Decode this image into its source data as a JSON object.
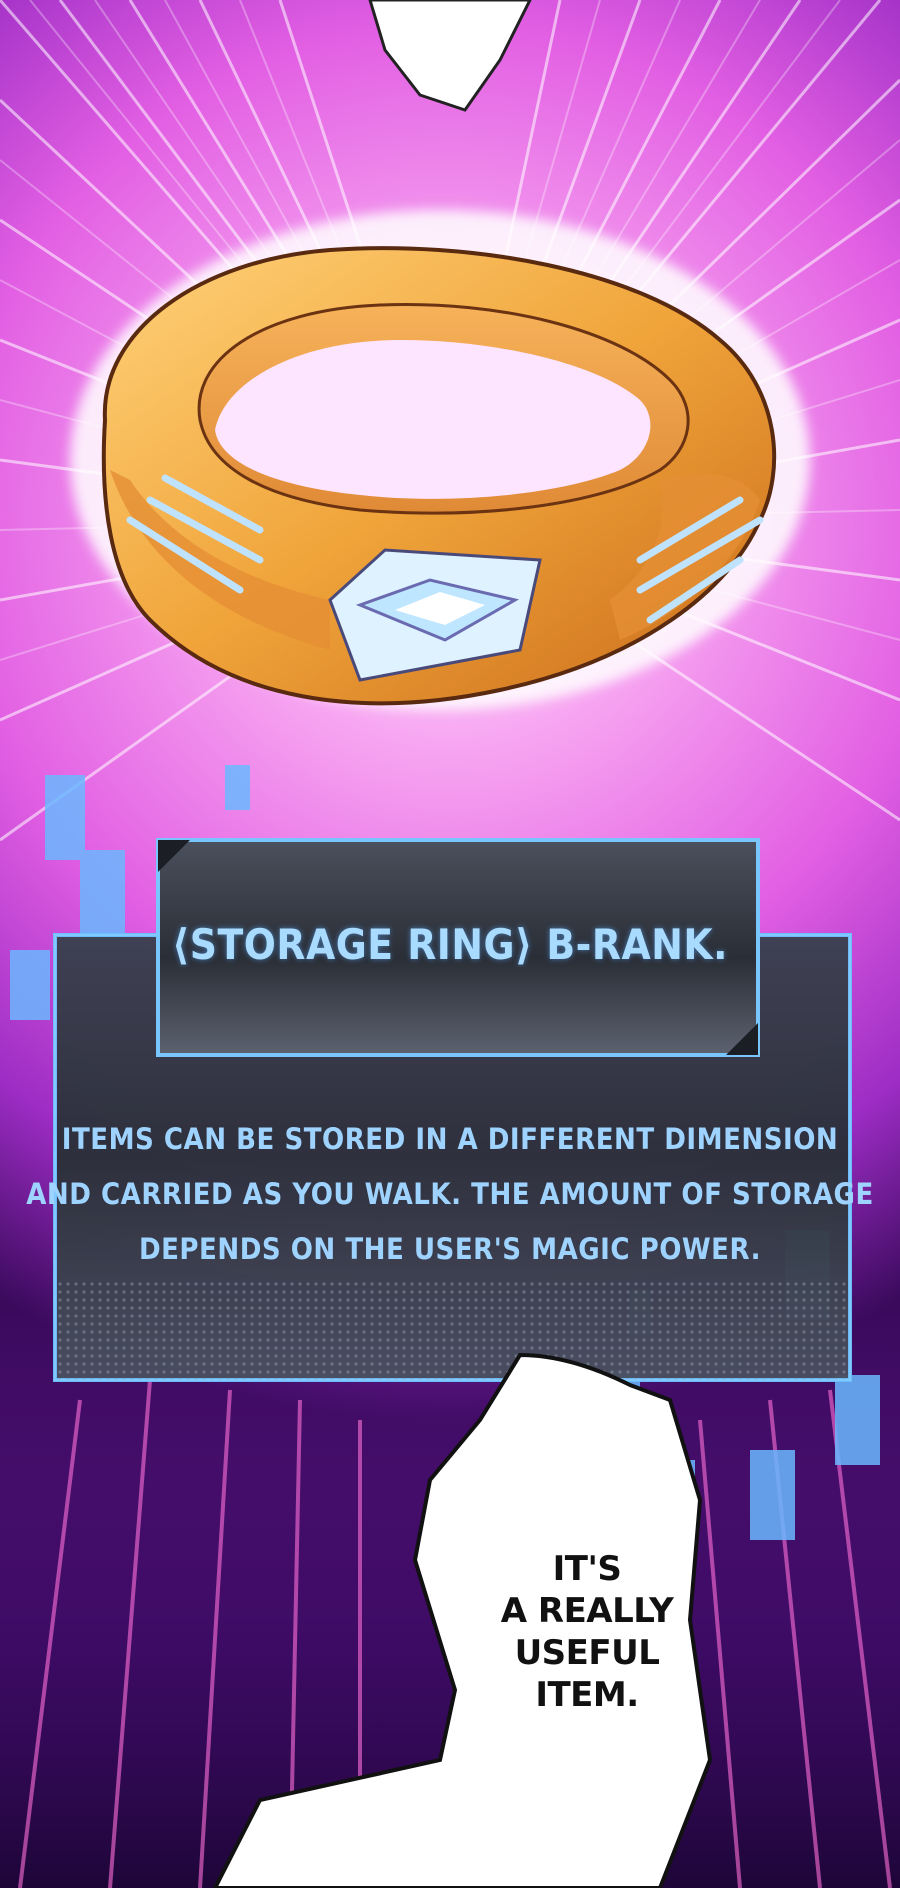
{
  "panel": {
    "title": "⟨STORAGE RING⟩ B-RANK.",
    "description_lines": [
      "ITEMS CAN BE STORED IN A DIFFERENT DIMENSION",
      "AND CARRIED AS YOU WALK. THE AMOUNT OF STORAGE",
      "DEPENDS ON THE USER'S MAGIC POWER."
    ]
  },
  "speech_bubble": {
    "lines": [
      "IT'S",
      "A REALLY",
      "USEFUL",
      "ITEM."
    ]
  },
  "colors": {
    "background_glow": "#f07cf0",
    "panel_text": "#9fd3ff",
    "ring_gold": "#f0a43a",
    "gem": "#bfe6ff"
  }
}
